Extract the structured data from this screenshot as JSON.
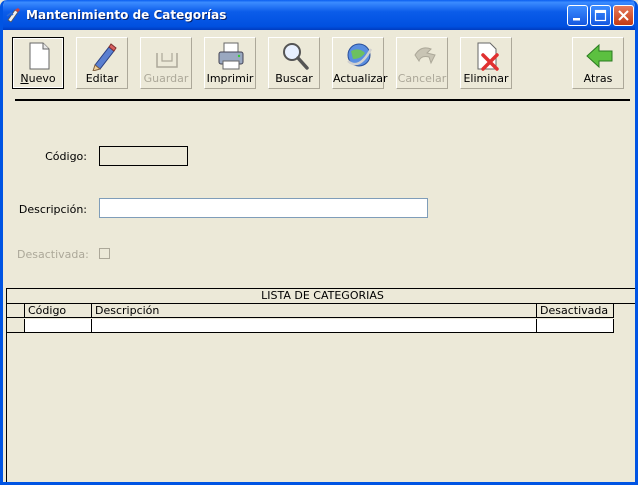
{
  "window": {
    "title": "Mantenimiento de Categorías"
  },
  "toolbar": {
    "buttons": [
      {
        "label": "Nuevo",
        "icon": "new-document-icon",
        "enabled": true,
        "pressed": true
      },
      {
        "label": "Editar",
        "icon": "pencil-icon",
        "enabled": true
      },
      {
        "label": "Guardar",
        "icon": "save-icon",
        "enabled": false
      },
      {
        "label": "Imprimir",
        "icon": "printer-icon",
        "enabled": true
      },
      {
        "label": "Buscar",
        "icon": "magnifier-icon",
        "enabled": true
      },
      {
        "label": "Actualizar",
        "icon": "refresh-globe-icon",
        "enabled": true
      },
      {
        "label": "Cancelar",
        "icon": "cancel-icon",
        "enabled": false
      },
      {
        "label": "Eliminar",
        "icon": "delete-document-icon",
        "enabled": true
      },
      {
        "label": "Atras",
        "icon": "back-arrow-icon",
        "enabled": true
      }
    ]
  },
  "form": {
    "codigo_label": "Código:",
    "codigo_value": "",
    "descripcion_label": "Descripción:",
    "descripcion_value": "",
    "desactivada_label": "Desactivada:",
    "desactivada_checked": false
  },
  "grid": {
    "title": "LISTA DE CATEGORIAS",
    "columns": [
      "Código",
      "Descripción",
      "Desactivada"
    ],
    "rows": [
      [
        "",
        "",
        ""
      ]
    ]
  },
  "colors": {
    "titlebar": "#0054e3",
    "window_bg": "#ece9d8",
    "close_button": "#c43a12",
    "disabled_text": "#aca899"
  }
}
